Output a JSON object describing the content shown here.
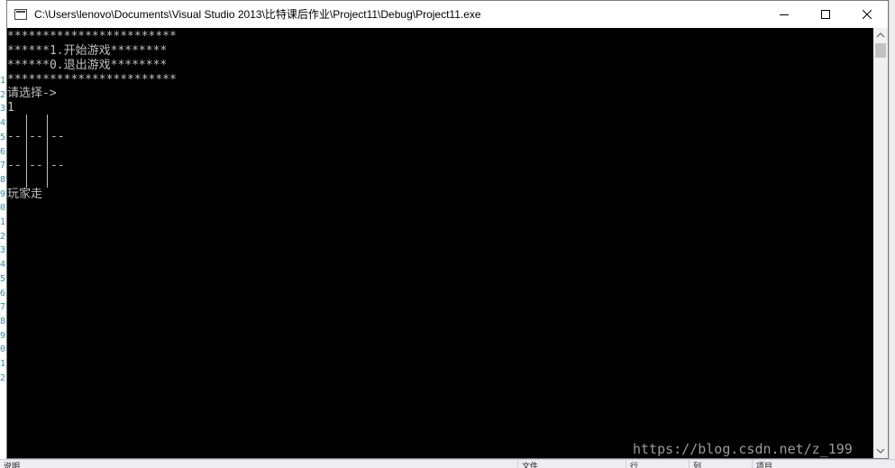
{
  "window": {
    "title": "C:\\Users\\lenovo\\Documents\\Visual Studio 2013\\比特课后作业\\Project11\\Debug\\Project11.exe",
    "icons": {
      "app": "console-app-icon",
      "minimize": "minimize-icon",
      "maximize": "maximize-icon",
      "close": "close-icon"
    }
  },
  "console": {
    "lines": [
      "************************",
      "******1.开始游戏********",
      "******0.退出游戏********",
      "************************",
      "请选择->",
      "1"
    ],
    "board": {
      "separator_row": "--",
      "rows": 3,
      "cols": 3
    },
    "status": "玩家走"
  },
  "background": {
    "line_numbers": [
      "1",
      "2",
      "3",
      "4",
      "5",
      "6",
      "7",
      "8",
      "9",
      "0",
      "1",
      "2",
      "3",
      "4",
      "5",
      "6",
      "7",
      "8",
      "9",
      "0",
      "1",
      "2"
    ],
    "status_cells": [
      "说明",
      "文件",
      "行",
      "列",
      "项目"
    ]
  },
  "watermark": "https://blog.csdn.net/z_199",
  "colors": {
    "console_bg": "#000000",
    "console_fg": "#c0c0c0",
    "line_number": "#2b91af"
  }
}
